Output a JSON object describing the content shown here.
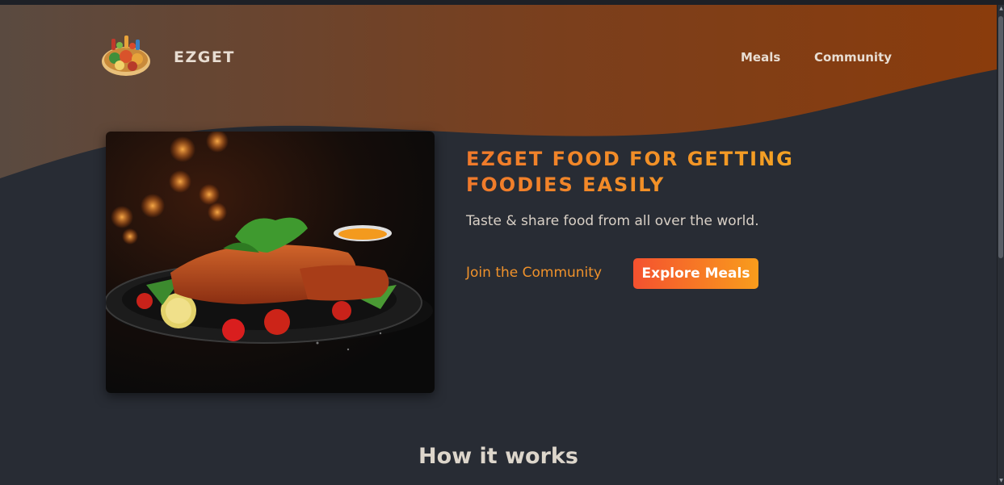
{
  "brand": {
    "name": "EZGET",
    "logo_icon": "food-platter-logo"
  },
  "nav": {
    "items": [
      {
        "label": "Meals"
      },
      {
        "label": "Community"
      }
    ]
  },
  "hero": {
    "title": "EZGET FOOD FOR GETTING FOODIES EASILY",
    "subtitle": "Taste & share food from all over the world.",
    "join_label": "Join the Community",
    "explore_label": "Explore Meals",
    "image_icon": "schnitzel-plate-photo"
  },
  "section": {
    "how_title": "How it works"
  },
  "colors": {
    "background": "#282c34",
    "header_gradient_start": "#5a4a40",
    "header_gradient_end": "#8a3c0c",
    "accent_orange": "#f0922b",
    "button_gradient_start": "#f4512f",
    "button_gradient_end": "#f99d1c"
  }
}
